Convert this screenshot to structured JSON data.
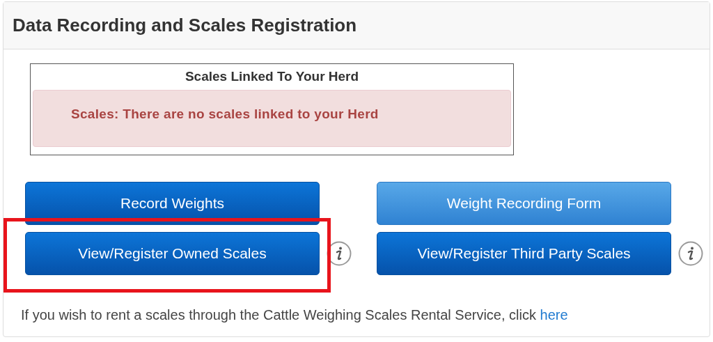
{
  "panel": {
    "title": "Data Recording and Scales Registration"
  },
  "scales_table": {
    "header": "Scales Linked To Your Herd",
    "alert": "Scales: There are no scales linked to your Herd"
  },
  "columns": [
    {
      "buttons": [
        {
          "label": "Record Weights",
          "kind": "primary",
          "info": false,
          "highlighted": false
        },
        {
          "label": "View/Register Owned Scales",
          "kind": "primary",
          "info": true,
          "highlighted": true
        }
      ]
    },
    {
      "buttons": [
        {
          "label": "Weight Recording Form",
          "kind": "light",
          "info": false,
          "highlighted": false
        },
        {
          "label": "View/Register Third Party Scales",
          "kind": "primary",
          "info": true,
          "highlighted": false
        }
      ]
    }
  ],
  "footer": {
    "text": "If you wish to rent a scales through the Cattle Weighing Scales Rental Service, click",
    "link": "here"
  }
}
